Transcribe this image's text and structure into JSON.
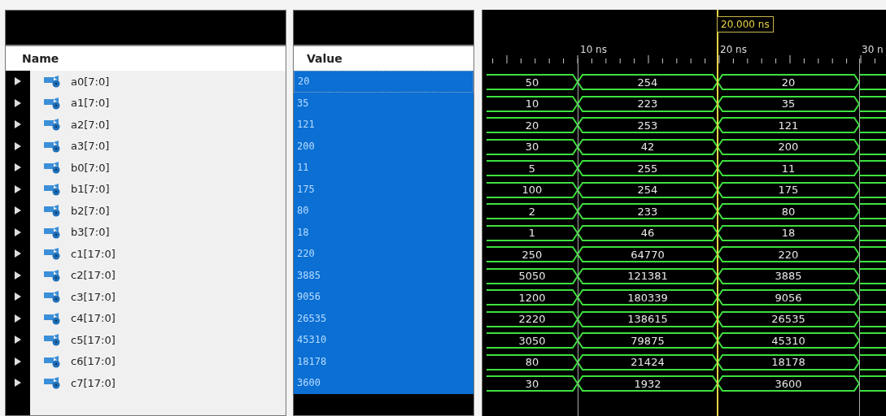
{
  "columns": {
    "name": "Name",
    "value": "Value"
  },
  "cursor": {
    "label": "20.000 ns"
  },
  "ruler": {
    "ticks": [
      "10 ns",
      "20 ns",
      "30 n"
    ]
  },
  "signals": [
    {
      "name": "a0[7:0]",
      "value": "20",
      "selected": true,
      "waves": [
        "50",
        "254",
        "20"
      ]
    },
    {
      "name": "a1[7:0]",
      "value": "35",
      "selected": true,
      "waves": [
        "10",
        "223",
        "35"
      ]
    },
    {
      "name": "a2[7:0]",
      "value": "121",
      "selected": true,
      "waves": [
        "20",
        "253",
        "121"
      ]
    },
    {
      "name": "a3[7:0]",
      "value": "200",
      "selected": true,
      "waves": [
        "30",
        "42",
        "200"
      ]
    },
    {
      "name": "b0[7:0]",
      "value": "11",
      "selected": true,
      "waves": [
        "5",
        "255",
        "11"
      ]
    },
    {
      "name": "b1[7:0]",
      "value": "175",
      "selected": true,
      "waves": [
        "100",
        "254",
        "175"
      ]
    },
    {
      "name": "b2[7:0]",
      "value": "80",
      "selected": true,
      "waves": [
        "2",
        "233",
        "80"
      ]
    },
    {
      "name": "b3[7:0]",
      "value": "18",
      "selected": true,
      "waves": [
        "1",
        "46",
        "18"
      ]
    },
    {
      "name": "c1[17:0]",
      "value": "220",
      "selected": true,
      "waves": [
        "250",
        "64770",
        "220"
      ]
    },
    {
      "name": "c2[17:0]",
      "value": "3885",
      "selected": true,
      "waves": [
        "5050",
        "121381",
        "3885"
      ]
    },
    {
      "name": "c3[17:0]",
      "value": "9056",
      "selected": true,
      "waves": [
        "1200",
        "180339",
        "9056"
      ]
    },
    {
      "name": "c4[17:0]",
      "value": "26535",
      "selected": true,
      "waves": [
        "2220",
        "138615",
        "26535"
      ]
    },
    {
      "name": "c5[17:0]",
      "value": "45310",
      "selected": true,
      "waves": [
        "3050",
        "79875",
        "45310"
      ]
    },
    {
      "name": "c6[17:0]",
      "value": "18178",
      "selected": true,
      "waves": [
        "80",
        "21424",
        "18178"
      ]
    },
    {
      "name": "c7[17:0]",
      "value": "3600",
      "selected": true,
      "waves": [
        "30",
        "1932",
        "3600"
      ]
    }
  ]
}
